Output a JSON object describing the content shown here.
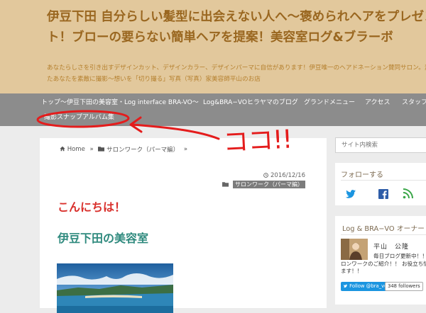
{
  "header": {
    "title_lines": [
      "伊豆下田 自分らしい髪型に出会えない人へ〜褒められヘアをプレゼン",
      "ト！ブローの要らない簡単ヘアを提案！美容室ログ&ブラーボ"
    ],
    "description_lines": [
      "あなたらしさを引き出すデザインカット、デザインカラー、デザインパーマに自信があります！伊豆唯一のヘアドネーション賛同サロン。素敵に",
      "たあなたを素敵に撮影〜想いを「切り撮る」写真（写真）家美容師平山のお店"
    ],
    "colors": {
      "background": "#e2c89c",
      "title": "#9a6720",
      "description": "#b5802e"
    }
  },
  "nav": {
    "items": [
      {
        "label": "トップ〜伊豆下田の美容室・Log interface BRA-VO〜"
      },
      {
        "label": "Log&BRA−VOヒラヤマのブログ"
      },
      {
        "label": "グランドメニュー"
      },
      {
        "label": "アクセス"
      },
      {
        "label": "スタッフ"
      }
    ],
    "second_row": {
      "label": "撮影スナップアルバム集"
    },
    "color": "#8c8c8c"
  },
  "breadcrumb": {
    "home_icon": "home-icon",
    "home": "Home",
    "separator": "»",
    "folder_icon": "folder-icon",
    "category": "サロンワーク（パーマ編）"
  },
  "post": {
    "date_icon": "clock-icon",
    "date": "2016/12/16",
    "category_icon": "folder-icon",
    "category": "サロンワーク（パーマ編）",
    "greeting": "こんにちは！",
    "heading": "伊豆下田の美容室",
    "greeting_color": "#d9302c",
    "heading_color": "#2f8a7e"
  },
  "sidebar": {
    "search_placeholder": "サイト内検索",
    "follow": {
      "title": "フォローする",
      "icons": [
        "twitter-icon",
        "facebook-icon",
        "rss-icon"
      ]
    },
    "owner": {
      "title": "Log & BRA−VO オーナー",
      "name": "平山　公隆",
      "text_lines": [
        "毎日ブログ更新中！！",
        "ロンワークのご紹介！！ お役立ち情報",
        "ます！！"
      ],
      "twitter_button": "Follow @bra_vo",
      "twitter_followers": "348 followers"
    }
  },
  "annotation": {
    "text": "ココ!!",
    "color": "#e41c1c"
  }
}
